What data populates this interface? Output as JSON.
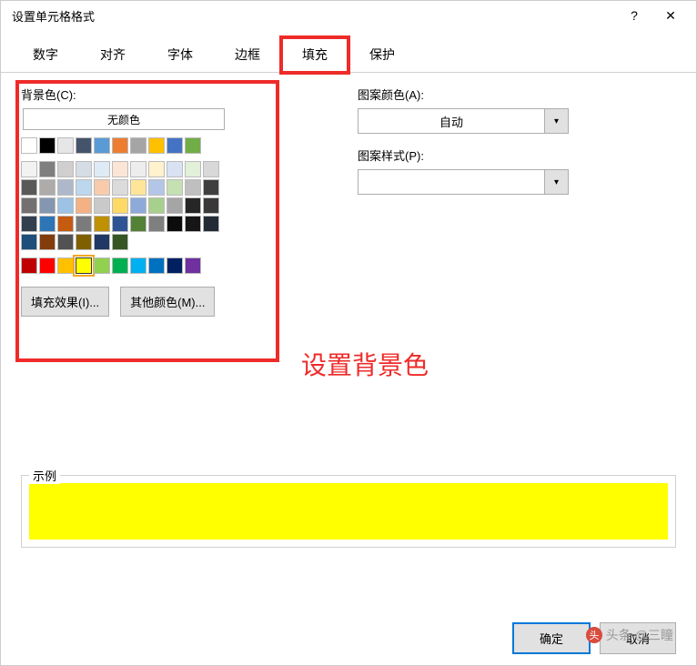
{
  "dialog": {
    "title": "设置单元格格式",
    "help": "?",
    "close": "✕"
  },
  "tabs": {
    "items": [
      "数字",
      "对齐",
      "字体",
      "边框",
      "填充",
      "保护"
    ],
    "active_index": 4
  },
  "fill": {
    "bg_label": "背景色(C):",
    "no_color": "无颜色",
    "effect_btn": "填充效果(I)...",
    "more_colors_btn": "其他颜色(M)...",
    "pattern_color_label": "图案颜色(A):",
    "pattern_color_value": "自动",
    "pattern_style_label": "图案样式(P):",
    "pattern_style_value": ""
  },
  "annotation": "设置背景色",
  "sample": {
    "label": "示例",
    "color": "#ffff00"
  },
  "buttons": {
    "ok": "确定",
    "cancel": "取消"
  },
  "watermark": "头条 @三瞳",
  "colors": {
    "row1": [
      "#ffffff",
      "#000000",
      "#e7e6e6",
      "#44546a",
      "#5b9bd5",
      "#ed7d31",
      "#a5a5a5",
      "#ffc000",
      "#4472c4",
      "#70ad47"
    ],
    "theme": [
      [
        "#f2f2f2",
        "#7f7f7f",
        "#d0cece",
        "#d6dce4",
        "#deebf6",
        "#fbe5d5",
        "#ededed",
        "#fff2cc",
        "#d9e2f3",
        "#e2efd9"
      ],
      [
        "#d8d8d8",
        "#595959",
        "#aeabab",
        "#adb9ca",
        "#bdd7ee",
        "#f7cbac",
        "#dbdbdb",
        "#fee599",
        "#b4c6e7",
        "#c5e0b3"
      ],
      [
        "#bfbfbf",
        "#3f3f3f",
        "#757070",
        "#8496b0",
        "#9cc3e5",
        "#f4b183",
        "#c9c9c9",
        "#ffd965",
        "#8eaadb",
        "#a8d08d"
      ],
      [
        "#a5a5a5",
        "#262626",
        "#3a3838",
        "#323f4f",
        "#2e75b5",
        "#c55a11",
        "#7b7b7b",
        "#bf9000",
        "#2f5496",
        "#538135"
      ],
      [
        "#7f7f7f",
        "#0c0c0c",
        "#171616",
        "#222a35",
        "#1e4e79",
        "#833c0b",
        "#525252",
        "#7f6000",
        "#1f3864",
        "#375623"
      ]
    ],
    "standard": [
      "#c00000",
      "#ff0000",
      "#ffc000",
      "#ffff00",
      "#92d050",
      "#00b050",
      "#00b0f0",
      "#0070c0",
      "#002060",
      "#7030a0"
    ],
    "selected": "#ffff00"
  }
}
